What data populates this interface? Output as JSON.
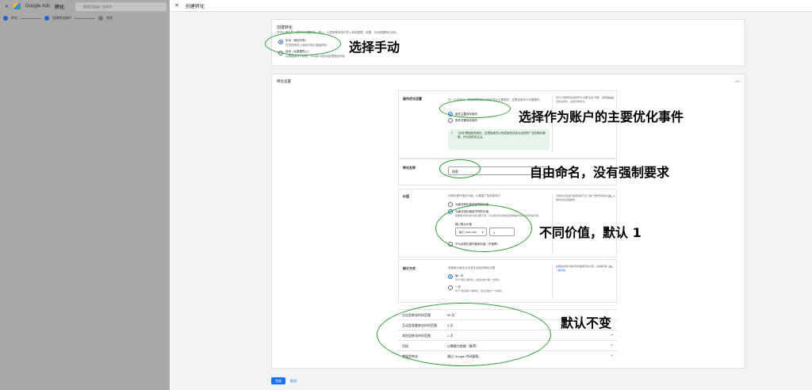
{
  "background": {
    "app_name": "Google Ads",
    "section": "转化",
    "search_placeholder": "搜索页面或广告系列",
    "steps": [
      "转化",
      "创建转化操作",
      "完成"
    ]
  },
  "topbar": {
    "title": "创建转化"
  },
  "create": {
    "heading": "创建转化",
    "desc": "您可以通过导入或手动创建转化，导入：从您其他系统中导入转化数据，设置：手动创建转化目标。",
    "opt1_title": "手动（添加代码）",
    "opt1_desc": "在您的网站上添加代码以衡量转化",
    "opt2_title": "自动（从数据导入）",
    "opt2_desc": "从数据源导入转化，Google 将自动处理相关转化"
  },
  "settings": {
    "heading": "转化设置",
    "goal": {
      "label": "操作优化设置",
      "desc": "在一个选项中，请选择是将该次转化作为主要操作，还是将其作为次要操作。",
      "opt_primary": "用作主要转化操作",
      "opt_secondary": "用作次要转化操作",
      "info": "\"目标\"是指相关转化。这里指某些以完成某些目标为目的的广告的转化数据，作为您的关注点。",
      "side": "您可以调整转化操作作为\"主要\"还是\"次要\"，使用账户级目标设置时，这会影响出价。"
    },
    "name": {
      "label": "转化名称",
      "value": "线索",
      "counter": "2 / 100",
      "side": "输入转化名称"
    },
    "value": {
      "label": "价值",
      "desc": "为转化操作指定价值，以衡量广告的影响力",
      "opt1": "为每次转化使用相同的价值",
      "opt2": "为每次转化使用不同的价值",
      "opt2_desc": "如果每次转化的价值可能不同，可以通过标记或在您的网站代码中动态传递价值。",
      "default_label": "输入默认价值",
      "currency": "美元 (USD US$)",
      "amount": "1",
      "opt3": "不为此转化操作使用价值（不推荐）",
      "side": "对转化价值进行衡量有助于您了解广告所带来的价值，以便优化投资回报率。"
    },
    "count": {
      "label": "统计方式",
      "desc": "选择统计每次点击或互动后的转化次数",
      "opt1": "每一次",
      "opt1_desc": "对于\"购买\"类转化，建议您统计每一次转化",
      "opt2": "一次",
      "opt2_desc": "对于\"潜在客户\"类转化，建议您统计一次转化",
      "side": "如果您的客户每次转化都能带来价值，请选择\"每一次\"。",
      "link": "了解详情"
    },
    "rows": [
      {
        "k": "点击型转化时间范围",
        "v": "90 天"
      },
      {
        "k": "互动型观看转化时间范围",
        "v": "3 天"
      },
      {
        "k": "浏览型转化时间范围",
        "v": "1 天"
      },
      {
        "k": "归因",
        "v": "以数据为依据（推荐）"
      },
      {
        "k": "增强型转化",
        "v": "通过 Google 代码管理。"
      }
    ]
  },
  "buttons": {
    "done": "完成",
    "cancel": "取消"
  },
  "annotations": {
    "a1": "选择手动",
    "a2": "选择作为账户的主要优化事件",
    "a3": "自由命名，没有强制要求",
    "a4": "不同价值，默认 1",
    "a5": "默认不变"
  }
}
